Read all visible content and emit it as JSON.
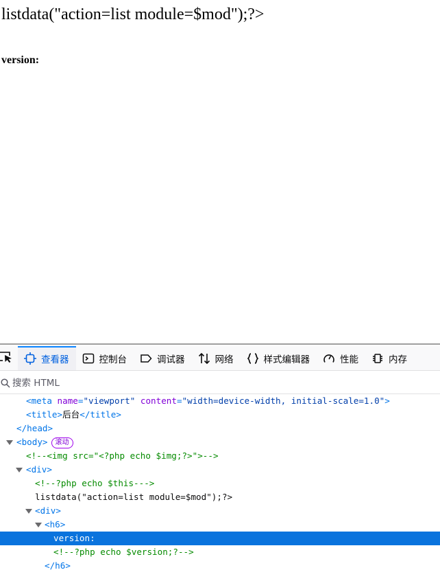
{
  "page": {
    "main_text": "listdata(\"action=list module=$mod\");?>",
    "h6_text": "version:"
  },
  "devtools": {
    "tabs": [
      {
        "label": "查看器",
        "icon": "inspector-icon",
        "selected": true
      },
      {
        "label": "控制台",
        "icon": "console-icon",
        "selected": false
      },
      {
        "label": "调试器",
        "icon": "debugger-icon",
        "selected": false
      },
      {
        "label": "网络",
        "icon": "network-icon",
        "selected": false
      },
      {
        "label": "样式编辑器",
        "icon": "style-editor-icon",
        "selected": false
      },
      {
        "label": "性能",
        "icon": "performance-icon",
        "selected": false
      },
      {
        "label": "内存",
        "icon": "memory-icon",
        "selected": false
      }
    ],
    "search_placeholder": "搜索 HTML",
    "tree": {
      "meta": {
        "tag": "meta",
        "attr1": "name",
        "val1": "\"viewport\"",
        "attr2": "content",
        "val2": "\"width=device-width, initial-scale=1.0\""
      },
      "title_open": "<title>",
      "title_text": "后台",
      "title_close": "</title>",
      "head_close": "</head>",
      "body_open": "<body>",
      "scroll_badge": "滚动",
      "comment_img": "<!--<img src=\"<?php echo $img;?>\">-->",
      "div_open": "<div>",
      "comment_this": "<!--?php echo $this--->",
      "listdata_text": "listdata(\"action=list module=$mod\");?>",
      "div2_open": "<div>",
      "h6_open": "<h6>",
      "version_text": "version:",
      "comment_version": "<!--?php echo $version;?-->",
      "h6_close": "</h6>"
    }
  },
  "colors": {
    "selected_row": "#0a73dd",
    "tag": "#0074e8",
    "comment": "#058b00",
    "accent": "#0060df"
  }
}
